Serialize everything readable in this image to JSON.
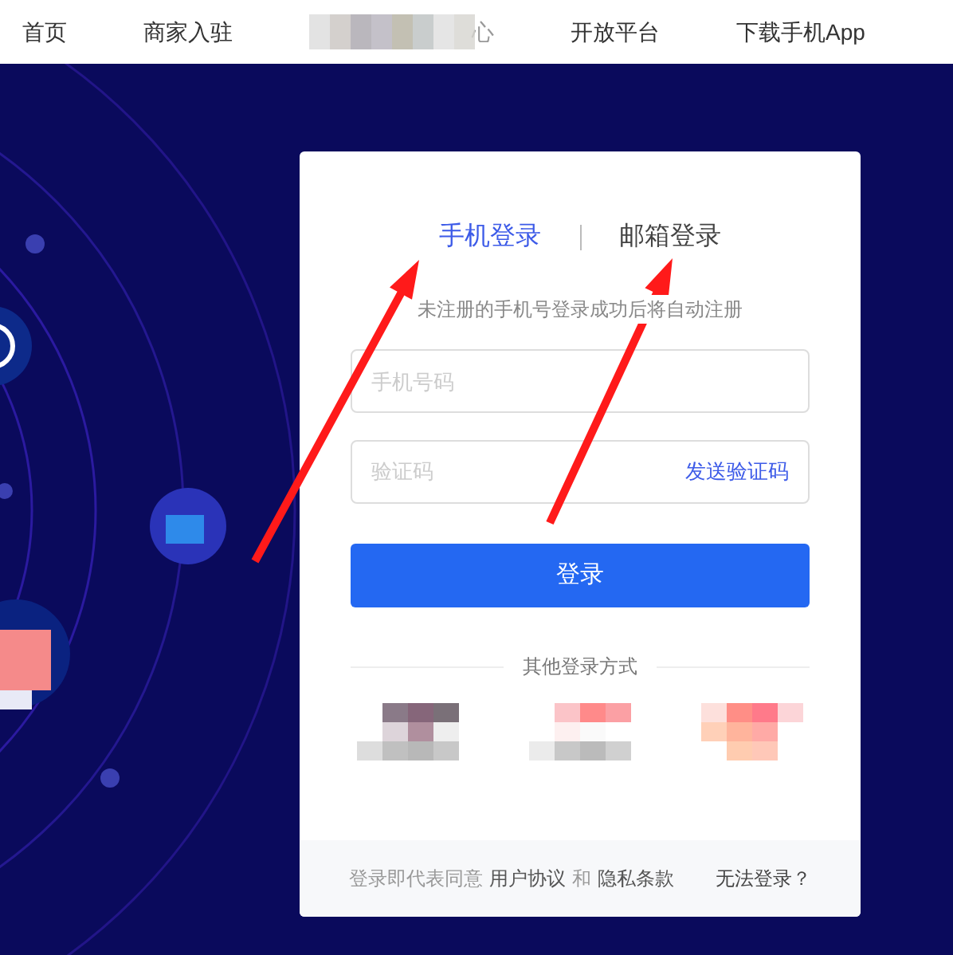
{
  "nav": [
    {
      "label": "首页",
      "blurred": false
    },
    {
      "label": "商家入驻",
      "blurred": false
    },
    {
      "label": "心",
      "blurred": true
    },
    {
      "label": "开放平台",
      "blurred": false
    },
    {
      "label": "下载手机App",
      "blurred": false
    }
  ],
  "login": {
    "tabs": [
      {
        "label": "手机登录",
        "selected": true
      },
      {
        "label": "邮箱登录",
        "selected": false
      }
    ],
    "hint": "未注册的手机号登录成功后将自动注册",
    "phone": {
      "placeholder": "手机号码"
    },
    "code": {
      "placeholder": "验证码"
    },
    "send_code": "发送验证码",
    "submit": "登录",
    "other_title": "其他登录方式",
    "footer": {
      "prefix": "登录即代表同意",
      "terms": "用户协议",
      "and": "和",
      "privacy": "隐私条款",
      "help": "无法登录？"
    }
  }
}
